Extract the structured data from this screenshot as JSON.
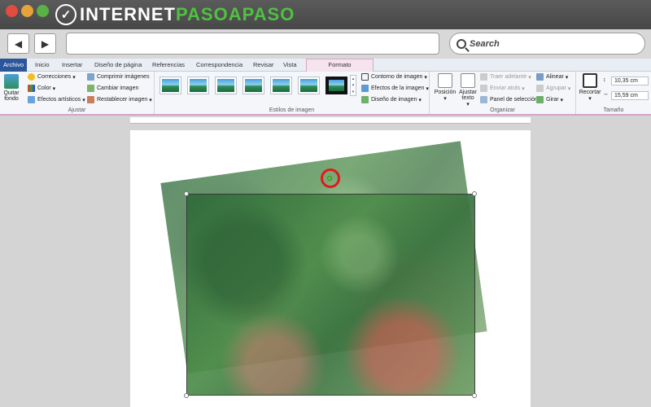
{
  "browser": {
    "logo_main": "INTERNET",
    "logo_accent": "PASOAPASO",
    "back_icon": "arrow-left-icon",
    "forward_icon": "arrow-right-icon",
    "search_label": "Search"
  },
  "ribbon": {
    "tabs": [
      "Archivo",
      "Inicio",
      "Insertar",
      "Diseño de página",
      "Referencias",
      "Correspondencia",
      "Revisar",
      "Vista"
    ],
    "contextual_tab": "Formato",
    "ajustar": {
      "quitar_fondo": "Quitar fondo",
      "correcciones": "Correcciones",
      "color": "Color",
      "efectos_artisticos": "Efectos artísticos",
      "comprimir": "Comprimir imágenes",
      "cambiar": "Cambiar imagen",
      "restablecer": "Restablecer imagen",
      "label": "Ajustar"
    },
    "estilos": {
      "label": "Estilos de imagen",
      "contorno": "Contorno de imagen",
      "efectos": "Efectos de la imagen",
      "diseno": "Diseño de imagen"
    },
    "organizar": {
      "posicion": "Posición",
      "ajustar_texto": "Ajustar texto",
      "traer": "Traer adelante",
      "enviar": "Enviar atrás",
      "panel": "Panel de selección",
      "alinear": "Alinear",
      "agrupar": "Agrupar",
      "girar": "Girar",
      "label": "Organizar"
    },
    "tamano": {
      "recortar": "Recortar",
      "alto": "10,35 cm",
      "ancho": "15,59 cm",
      "label": "Tamaño"
    }
  }
}
